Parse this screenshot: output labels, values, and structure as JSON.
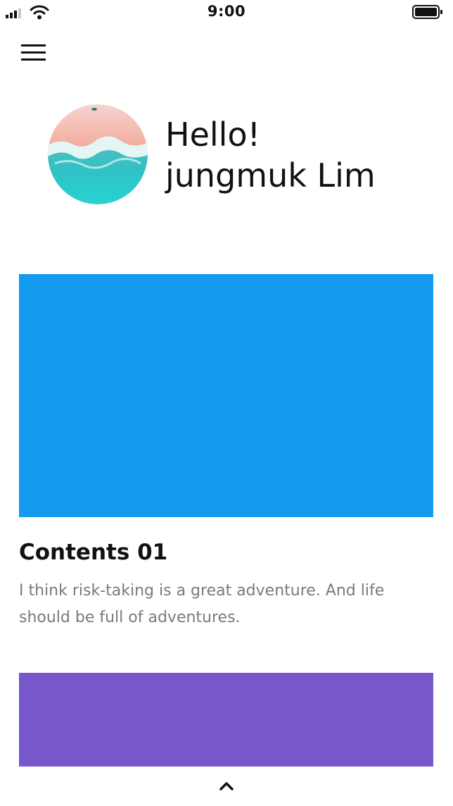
{
  "status_bar": {
    "time": "9:00",
    "icons": [
      "signal-icon",
      "wifi-icon",
      "battery-icon"
    ]
  },
  "header": {
    "menu_icon": "hamburger-menu-icon"
  },
  "profile": {
    "greeting_line1": "Hello!",
    "greeting_line2": "jungmuk Lim"
  },
  "cards": [
    {
      "image_color": "#1399EE",
      "title": "Contents 01",
      "description": "I think risk-taking is a great adventure. And life should be full of adventures."
    },
    {
      "image_color": "#7857CB"
    }
  ],
  "footer": {
    "scroll_icon": "chevron-up-icon"
  },
  "colors": {
    "background": "#FFFFFF",
    "text": "#111111",
    "muted_text": "#7A7A7A"
  }
}
